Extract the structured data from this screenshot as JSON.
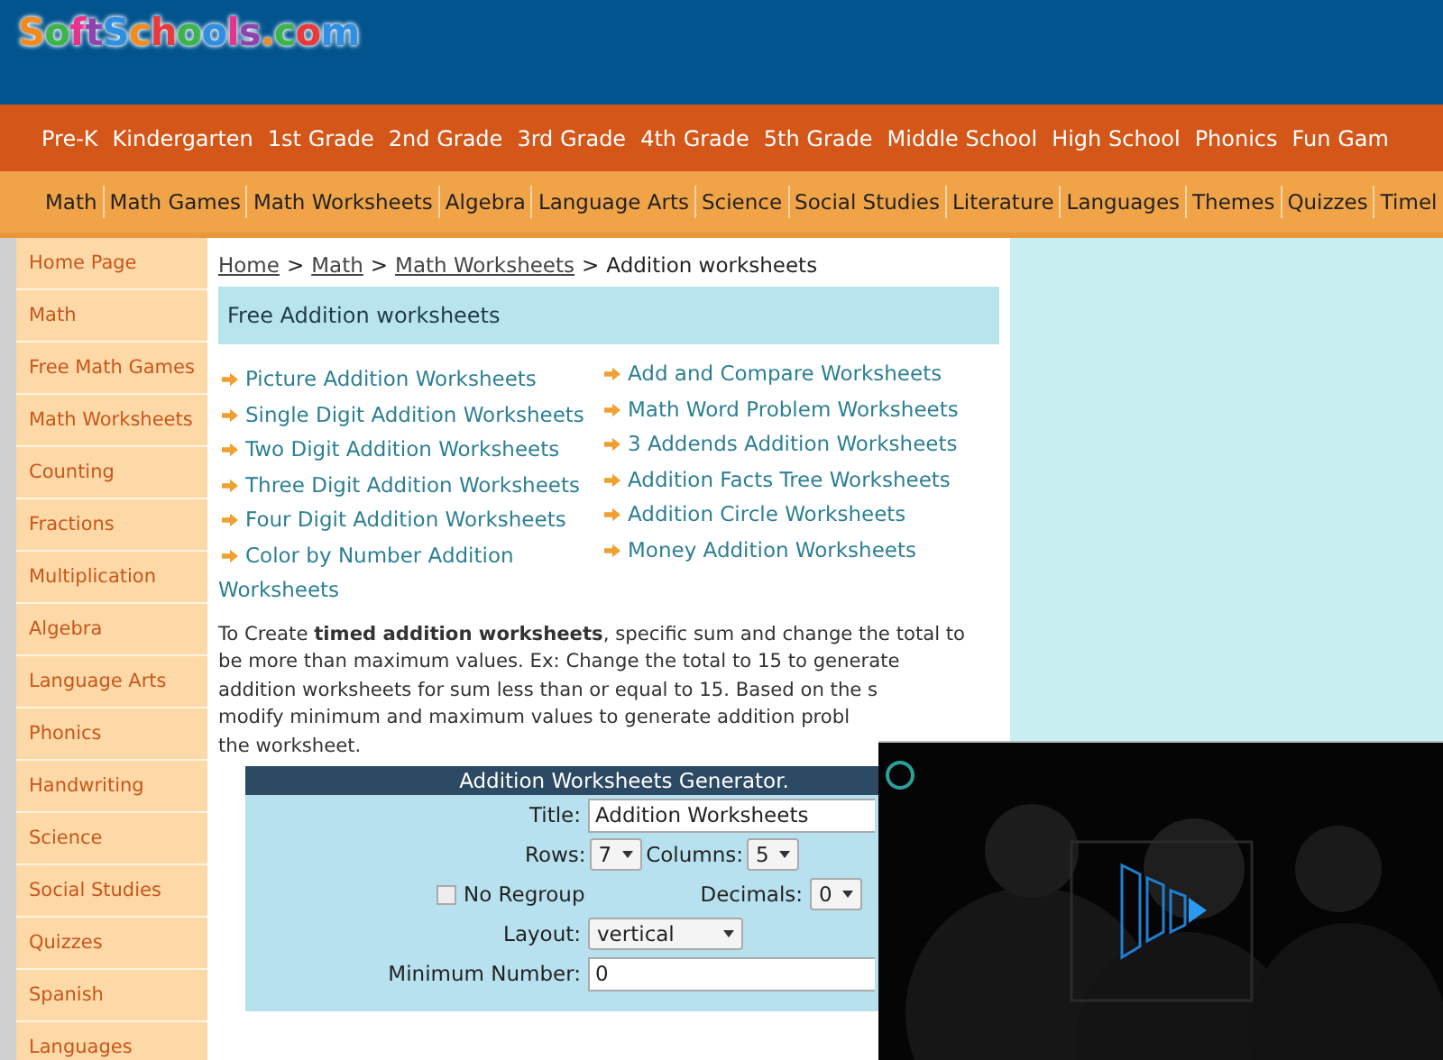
{
  "header": {
    "logo": "SoftSchools.com"
  },
  "grade_nav": [
    "Pre-K",
    "Kindergarten",
    "1st Grade",
    "2nd Grade",
    "3rd Grade",
    "4th Grade",
    "5th Grade",
    "Middle School",
    "High School",
    "Phonics",
    "Fun Gam"
  ],
  "subject_nav": [
    "Math",
    "Math Games",
    "Math Worksheets",
    "Algebra",
    "Language Arts",
    "Science",
    "Social Studies",
    "Literature",
    "Languages",
    "Themes",
    "Quizzes",
    "Timel"
  ],
  "sidebar": {
    "items": [
      "Home Page",
      "Math",
      "Free Math Games",
      "Math Worksheets",
      "Counting",
      "Fractions",
      "Multiplication",
      "Algebra",
      "Language Arts",
      "Phonics",
      "Handwriting",
      "Science",
      "Social Studies",
      "Quizzes",
      "Spanish",
      "Languages"
    ]
  },
  "breadcrumb": [
    {
      "label": "Home",
      "link": true
    },
    {
      "separator": ">",
      "label": "Math",
      "link": true
    },
    {
      "separator": ">",
      "label": "Math Worksheets",
      "link": true
    },
    {
      "separator": ">",
      "label": "Addition worksheets",
      "link": false
    }
  ],
  "section_title": "Free Addition worksheets",
  "links": {
    "column_1": [
      "Picture Addition Worksheets",
      "Single Digit Addition Worksheets",
      "Two Digit Addition Worksheets",
      "Three Digit Addition Worksheets",
      "Four Digit Addition Worksheets",
      "Color by Number Addition Worksheets"
    ],
    "column_2": [
      "Add and Compare Worksheets",
      "Math Word Problem Worksheets",
      "3 Addends Addition Worksheets",
      "Addition Facts Tree Worksheets",
      "Addition Circle Worksheets",
      "Money Addition Worksheets"
    ]
  },
  "intro_lines": [
    "To Create **timed addition worksheets**, specific sum and change the total to",
    "be more than maximum values. Ex: Change the total to 15 to generate",
    "addition worksheets for sum less than or equal to 15. Based on the s",
    "modify minimum and maximum values to generate addition probl",
    "the worksheet."
  ],
  "generator": {
    "title": "Addition Worksheets Generator.",
    "fields": [
      {
        "kind": "text",
        "label": "Title:",
        "value": "Addition Worksheets"
      },
      {
        "kind": "pair",
        "label": "Rows:",
        "value": "7",
        "label_2": "Columns:",
        "value_2": "5"
      },
      {
        "kind": "check",
        "label": "No Regroup",
        "checked": false,
        "label_2": "Decimals:",
        "value_2": "0"
      },
      {
        "kind": "select",
        "label": "Layout:",
        "value": "vertical"
      },
      {
        "kind": "text",
        "label": "Minimum Number:",
        "value": "0"
      }
    ]
  },
  "video": {
    "kind": "picture"
  }
}
